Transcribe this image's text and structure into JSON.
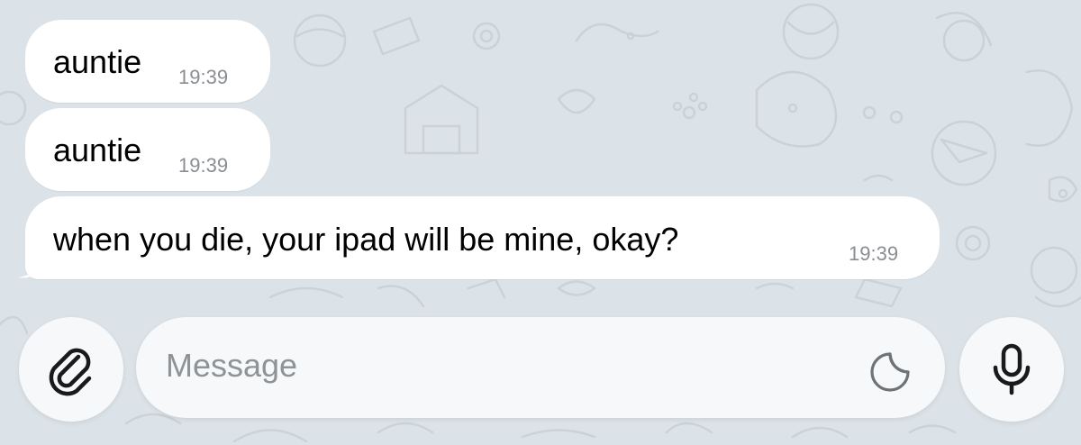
{
  "chat": {
    "messages": [
      {
        "text": "auntie",
        "time": "19:39"
      },
      {
        "text": "auntie",
        "time": "19:39"
      },
      {
        "text": "when you die, your ipad will be mine, okay?",
        "time": "19:39"
      }
    ]
  },
  "composer": {
    "placeholder": "Message",
    "attach_icon": "paperclip-icon",
    "sticker_icon": "sticker-icon",
    "mic_icon": "microphone-icon"
  },
  "colors": {
    "background": "#dce3e8",
    "bubble": "#ffffff",
    "timestamp": "#8a8d91",
    "placeholder": "#8e9398"
  }
}
